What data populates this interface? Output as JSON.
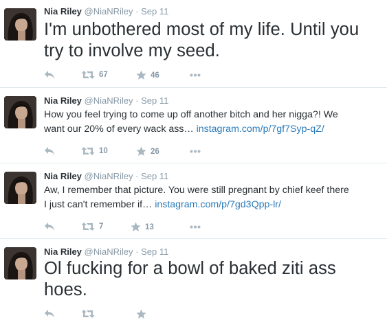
{
  "tweets": [
    {
      "name": "Nia Riley",
      "handle": "@NiaNRiley",
      "dot": "·",
      "date": "Sep 11",
      "text": "I'm unbothered most of my life. Until you try to involve my seed.",
      "link": "",
      "retweets": "67",
      "favorites": "46"
    },
    {
      "name": "Nia Riley",
      "handle": "@NiaNRiley",
      "dot": "·",
      "date": "Sep 11",
      "text_line1": "How you feel trying to come up off another bitch and her nigga?! We",
      "text_line2": "want our 20% of every wack ass…",
      "link": "instagram.com/p/7gf7Syp-qZ/",
      "retweets": "10",
      "favorites": "26"
    },
    {
      "name": "Nia Riley",
      "handle": "@NiaNRiley",
      "dot": "·",
      "date": "Sep 11",
      "text_line1": "Aw, I remember that picture. You were still pregnant by chief keef there",
      "text_line2": "I just can't remember if…",
      "link": "instagram.com/p/7gd3Qpp-lr/",
      "retweets": "7",
      "favorites": "13"
    },
    {
      "name": "Nia Riley",
      "handle": "@NiaNRiley",
      "dot": "·",
      "date": "Sep 11",
      "text": "Ol fucking for a bowl of baked ziti ass hoes.",
      "link": "",
      "retweets": "",
      "favorites": ""
    }
  ],
  "colors": {
    "text": "#292f33",
    "muted": "#8899a6",
    "link": "#2b7bb9",
    "divider": "#e1e8ed"
  },
  "icons": [
    "reply-icon",
    "retweet-icon",
    "favorite-star-icon",
    "more-dots-icon"
  ]
}
